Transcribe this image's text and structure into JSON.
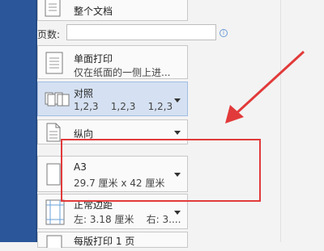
{
  "print": {
    "whole_doc": {
      "label": "整个文档"
    },
    "pages": {
      "label": "页数:",
      "value": "",
      "info_glyph": "i"
    },
    "sides": {
      "title": "单面打印",
      "subtitle": "仅在纸面的一侧上进..."
    },
    "collate": {
      "title": "对照",
      "subtitle": "1,2,3    1,2,3    1,2,3"
    },
    "orientation": {
      "title": "纵向"
    },
    "paper_size": {
      "title": "A3",
      "subtitle": "29.7 厘米 x 42 厘米"
    },
    "margins": {
      "title": "正常边距",
      "subtitle": "左: 3.18 厘米    右: 3...."
    },
    "pages_per_sheet": {
      "title": "每版打印 1 页"
    }
  },
  "colors": {
    "accent": "#2b579a",
    "annotation": "#e23a3a",
    "selected": "#d5e1f2"
  }
}
